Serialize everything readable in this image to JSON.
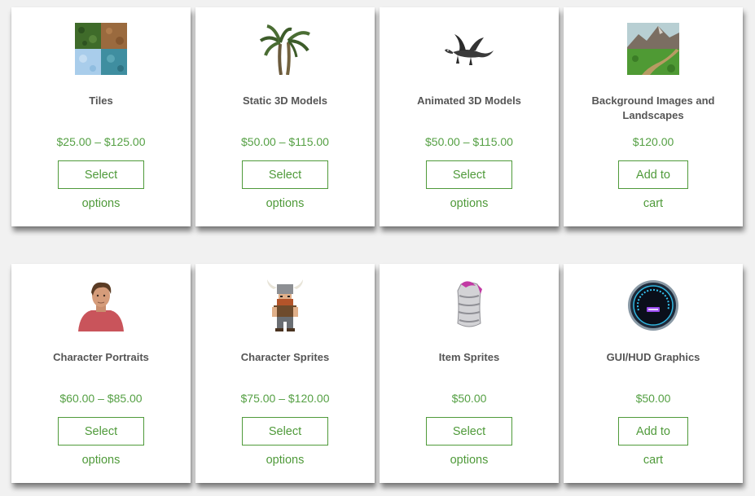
{
  "products": [
    {
      "title": "Tiles",
      "price": "$25.00 – $125.00",
      "button": "Select options",
      "icon": "tiles-icon"
    },
    {
      "title": "Static 3D Models",
      "price": "$50.00 – $115.00",
      "button": "Select options",
      "icon": "palm-tree-icon"
    },
    {
      "title": "Animated 3D Models",
      "price": "$50.00 – $115.00",
      "button": "Select options",
      "icon": "dragon-icon"
    },
    {
      "title": "Background Images and Landscapes",
      "price": "$120.00",
      "button": "Add to cart",
      "icon": "landscape-icon"
    },
    {
      "title": "Character Portraits",
      "price": "$60.00 – $85.00",
      "button": "Select options",
      "icon": "portrait-icon"
    },
    {
      "title": "Character Sprites",
      "price": "$75.00 – $120.00",
      "button": "Select options",
      "icon": "viking-sprite-icon"
    },
    {
      "title": "Item Sprites",
      "price": "$50.00",
      "button": "Select options",
      "icon": "armor-icon"
    },
    {
      "title": "GUI/HUD Graphics",
      "price": "$50.00",
      "button": "Add to cart",
      "icon": "gauge-icon"
    }
  ],
  "colors": {
    "price": "#55a044",
    "button_border": "#4f9a3a",
    "title": "#555555",
    "background": "#f1f1f1"
  }
}
